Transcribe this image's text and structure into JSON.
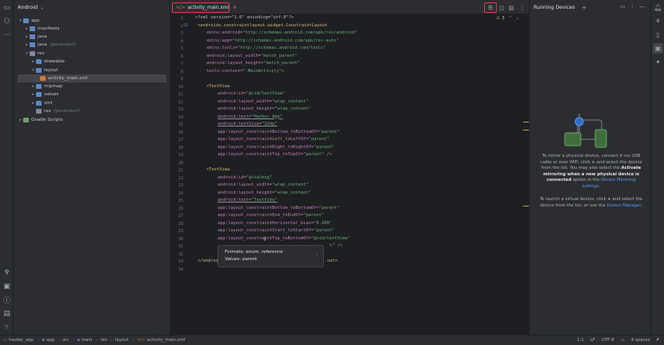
{
  "project_panel": {
    "title": "Android",
    "tree": [
      {
        "label": "app",
        "muted": ""
      },
      {
        "label": "manifests",
        "muted": ""
      },
      {
        "label": "java",
        "muted": ""
      },
      {
        "label": "java",
        "muted": "(generated)"
      },
      {
        "label": "res",
        "muted": ""
      },
      {
        "label": "drawable",
        "muted": ""
      },
      {
        "label": "layout",
        "muted": ""
      },
      {
        "label": "activity_main.xml",
        "muted": ""
      },
      {
        "label": "mipmap",
        "muted": ""
      },
      {
        "label": "values",
        "muted": ""
      },
      {
        "label": "xml",
        "muted": ""
      },
      {
        "label": "res",
        "muted": "(generated)"
      },
      {
        "label": "Gradle Scripts",
        "muted": ""
      }
    ]
  },
  "editor": {
    "tab_label": "activity_main.xml",
    "tab_prefix": "</>",
    "warning_count": "3",
    "line_numbers": [
      "1",
      "2",
      "3",
      "4",
      "5",
      "6",
      "7",
      "8",
      "9",
      "10",
      "11",
      "12",
      "13",
      "14",
      "15",
      "16",
      "17",
      "18",
      "19",
      "20",
      "21",
      "22",
      "23",
      "24",
      "25",
      "26",
      "27",
      "28",
      "29",
      "30",
      "31",
      "32",
      "33",
      "34"
    ],
    "lines": {
      "l1": "<?xml version=\"1.0\" encoding=\"utf-8\"?>",
      "l2": "<androidx.constraintlayout.widget.ConstraintLayout",
      "l3a": "xmlns:android=",
      "l3b": "\"http://schemas.android.com/apk/res/android\"",
      "l4a": "xmlns:app=",
      "l4b": "\"http://schemas.android.com/apk/res-auto\"",
      "l5a": "xmlns:tools=",
      "l5b": "\"http://schemas.android.com/tools\"",
      "l6a": "android:layout_width=",
      "l6b": "\"match_parent\"",
      "l7a": "android:layout_height=",
      "l7b": "\"match_parent\"",
      "l8a": "tools:context=",
      "l8b": "\".MainActivity\">",
      "l10": "<TextView",
      "l11a": "android:id=",
      "l11b": "\"@+id/textView\"",
      "l12a": "android:layout_width=",
      "l12b": "\"wrap_content\"",
      "l13a": "android:layout_height=",
      "l13b": "\"wrap_content\"",
      "l14a": "android:text=",
      "l14b": "\"Hacker App\"",
      "l15a": "android:textSize=",
      "l15b": "\"32dp\"",
      "l16a": "app:layout_constraintBottom_toBottomOf=",
      "l16b": "\"parent\"",
      "l17a": "app:layout_constraintLeft_toLeftOf=",
      "l17b": "\"parent\"",
      "l18a": "app:layout_constraintRight_toRightOf=",
      "l18b": "\"parent\"",
      "l19a": "app:layout_constraintTop_toTopOf=",
      "l19b": "\"parent\" />",
      "l21": "<TextView",
      "l22a": "android:id=",
      "l22b": "\"@+id/msg\"",
      "l23a": "android:layout_width=",
      "l23b": "\"wrap_content\"",
      "l24a": "android:layout_height=",
      "l24b": "\"wrap_content\"",
      "l25a": "android:text=",
      "l25b": "\"TextView\"",
      "l26a": "app:layout_constraintBottom_toBottomOf=",
      "l26b": "\"parent\"",
      "l27a": "app:layout_constraintEnd_toEndOf=",
      "l27b": "\"parent\"",
      "l28a": "app:layout_constraintHorizontal_bias=",
      "l28b": "\"0.498\"",
      "l29a": "app:layout_constraintStart_toStartOf=",
      "l29b": "\"parent\"",
      "l30a": "app:layout_constraintTop_toBottomOf=",
      "l30b": "\"@+id/textView\"",
      "l31": "t\" />",
      "l33a": "</androi",
      "l33b": "out>"
    },
    "tooltip": {
      "formats": "Formats: enum, reference",
      "values": "Values: parent"
    }
  },
  "running_devices": {
    "title": "Running Devices",
    "mirror_1": "To mirror a physical device, connect it via USB cable or over WiFi, click",
    "mirror_2": "and select the device from the list. You may also select the",
    "mirror_3": "Activate mirroring when a new physical device is connected",
    "mirror_4": "option in the",
    "mirror_link": "Device Mirroring settings",
    "launch_1": "To launch a virtual device, click",
    "launch_2": "and select the device from the list, or use the",
    "launch_link": "Device Manager"
  },
  "status_bar": {
    "breadcrumbs": [
      "hacker_app",
      "app",
      "src",
      "main",
      "res",
      "layout",
      "activity_main.xml"
    ],
    "position": "1:1",
    "line_sep": "LF",
    "encoding": "UTF-8",
    "indent": "4 spaces"
  },
  "colors": {
    "highlight_border": "#e03b4a",
    "background": "#1e1f22",
    "panel": "#2b2d30",
    "link": "#589df6"
  }
}
